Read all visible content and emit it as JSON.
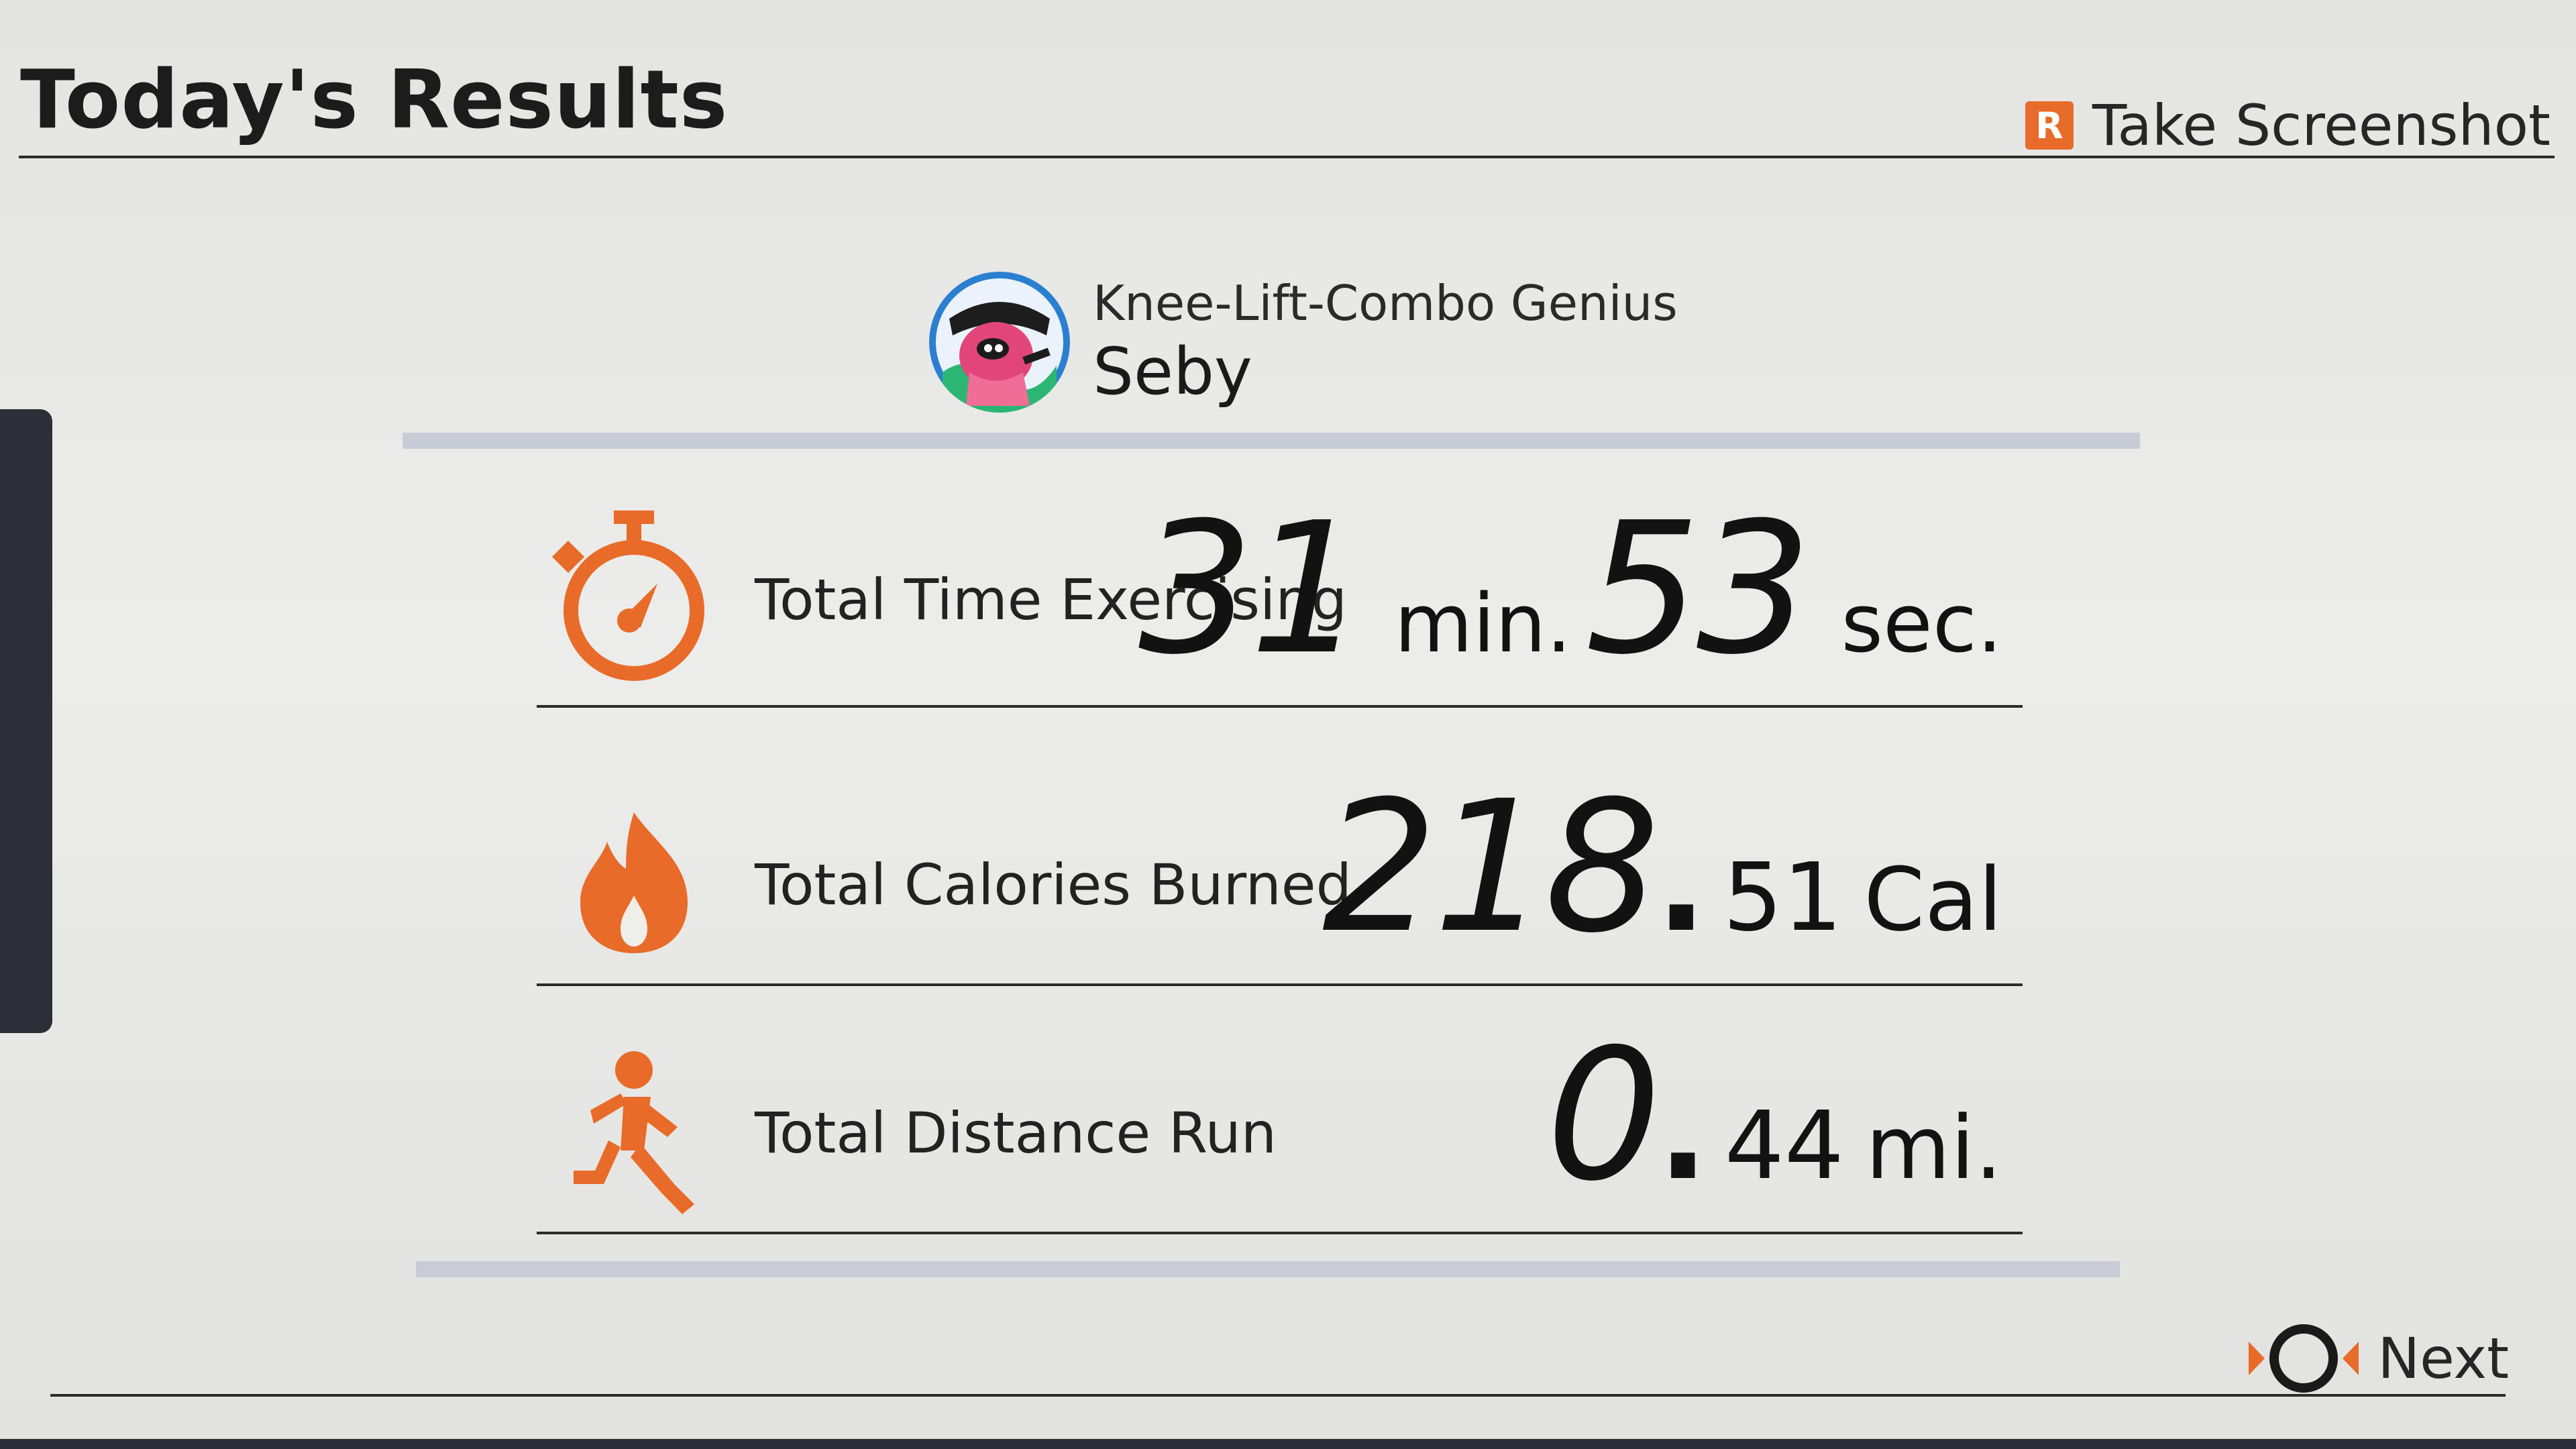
{
  "header": {
    "title": "Today's Results",
    "screenshot_button_glyph": "R",
    "screenshot_label": "Take Screenshot"
  },
  "profile": {
    "title": "Knee-Lift-Combo Genius",
    "name": "Seby",
    "avatar_icon": "avatar-image"
  },
  "stats": {
    "time": {
      "icon": "stopwatch-icon",
      "label": "Total Time Exercising",
      "minutes": "31",
      "minutes_unit": "min.",
      "seconds": "53",
      "seconds_unit": "sec."
    },
    "calories": {
      "icon": "flame-icon",
      "label": "Total Calories Burned",
      "whole": "218",
      "separator": ".",
      "fraction": "51",
      "unit": "Cal"
    },
    "distance": {
      "icon": "running-person-icon",
      "label": "Total Distance Run",
      "whole": "0",
      "separator": ".",
      "fraction": "44",
      "unit": "mi."
    }
  },
  "footer": {
    "next_icon": "next-button-icon",
    "next_label": "Next"
  },
  "colors": {
    "accent": "#e86b2a",
    "background": "#e8e8e6",
    "band": "#c9ccd6",
    "text": "#1a1a1a"
  }
}
